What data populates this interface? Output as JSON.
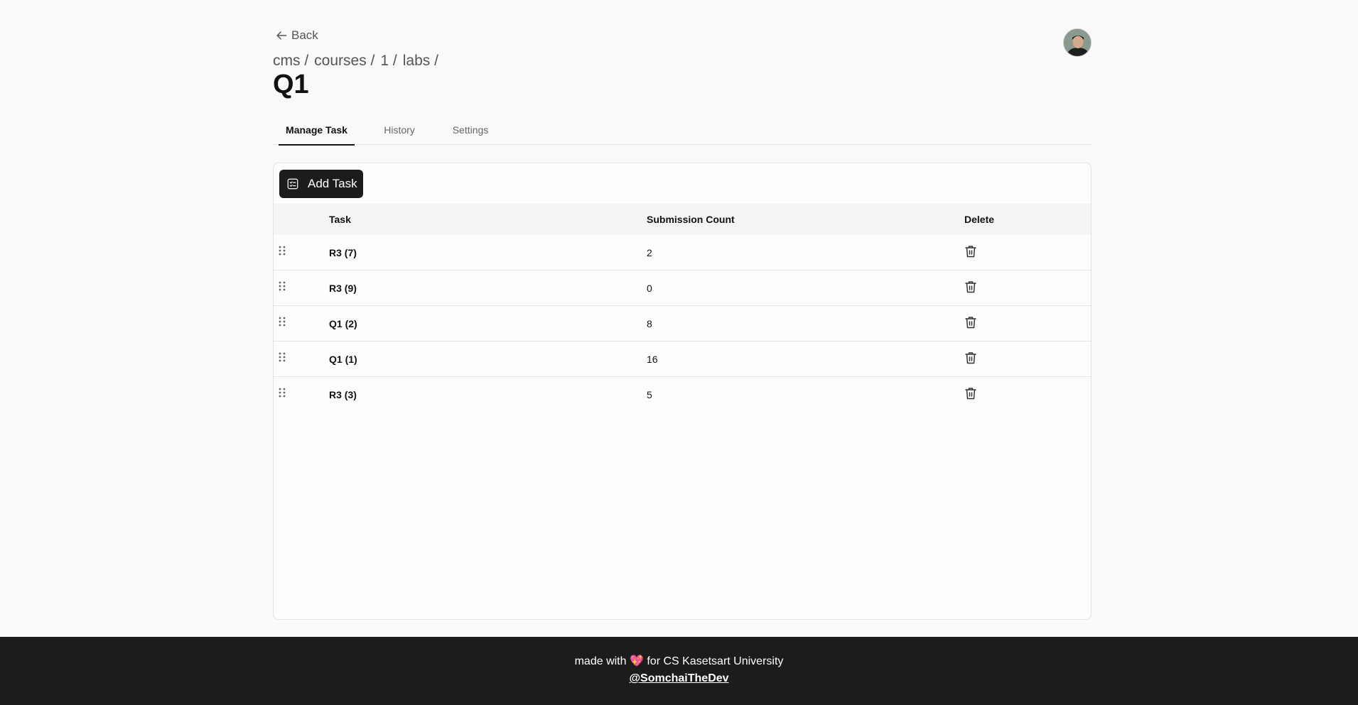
{
  "nav": {
    "back_label": "Back"
  },
  "breadcrumb": [
    "cms /",
    "courses /",
    "1 /",
    "labs /"
  ],
  "page_title": "Q1",
  "tabs": [
    {
      "label": "Manage Task",
      "active": true
    },
    {
      "label": "History",
      "active": false
    },
    {
      "label": "Settings",
      "active": false
    }
  ],
  "toolbar": {
    "add_task_label": "Add Task"
  },
  "table": {
    "columns": [
      "Task",
      "Submission Count",
      "Delete"
    ],
    "rows": [
      {
        "task": "R3 (7)",
        "count": "2"
      },
      {
        "task": "R3 (9)",
        "count": "0"
      },
      {
        "task": "Q1 (2)",
        "count": "8"
      },
      {
        "task": "Q1 (1)",
        "count": "16"
      },
      {
        "task": "R3 (3)",
        "count": "5"
      }
    ]
  },
  "footer": {
    "made_with": "made with",
    "heart": "💖",
    "for_text": "for CS Kasetsart University",
    "author": "@SomchaiTheDev"
  },
  "icons": {
    "back": "arrow-left-icon",
    "add": "checklist-icon",
    "drag": "grip-vertical-icon",
    "delete": "trash-icon"
  },
  "colors": {
    "background": "#f9f9f9",
    "button": "#1c1c1c",
    "footer": "#1c1c1c",
    "heart": "#ff5ea8"
  }
}
